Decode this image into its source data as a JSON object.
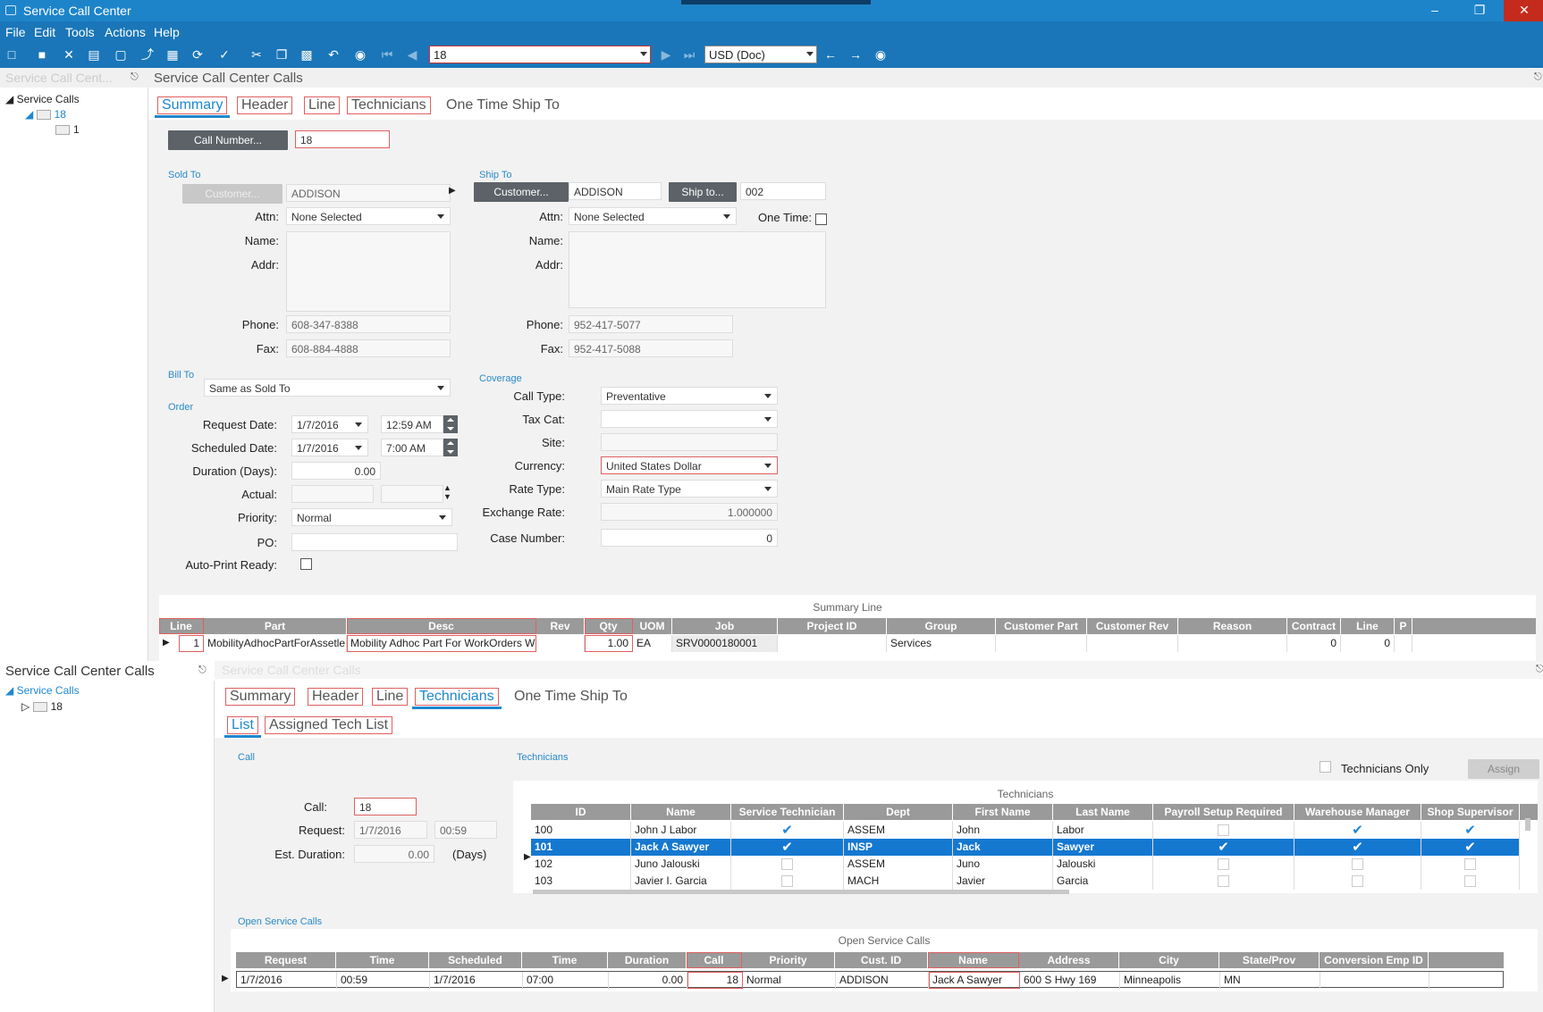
{
  "window": {
    "title": "Service Call Center",
    "min": "–",
    "restore": "❐",
    "close": "✕"
  },
  "menu": [
    "File",
    "Edit",
    "Tools",
    "Actions",
    "Help"
  ],
  "toolbar": {
    "record_value": "18",
    "currency": "USD (Doc)"
  },
  "top_pane": {
    "left_header": "Service Call Cent...",
    "header": "Service Call Center Calls",
    "tree": {
      "root": "Service Calls",
      "child": "18",
      "leaf": "1"
    },
    "tabs": [
      "Summary",
      "Header",
      "Line",
      "Technicians",
      "One Time Ship To"
    ],
    "call_number_btn": "Call Number...",
    "call_number": "18",
    "sold_to": {
      "section": "Sold To",
      "customer_btn": "Customer...",
      "customer": "ADDISON",
      "attn_label": "Attn:",
      "attn": "None Selected",
      "name_label": "Name:",
      "addr_label": "Addr:",
      "phone_label": "Phone:",
      "phone": "608-347-8388",
      "fax_label": "Fax:",
      "fax": "608-884-4888"
    },
    "ship_to": {
      "section": "Ship To",
      "customer_btn": "Customer...",
      "customer": "ADDISON",
      "shipto_btn": "Ship to...",
      "shipto": "002",
      "attn_label": "Attn:",
      "attn": "None Selected",
      "onetime_label": "One Time:",
      "name_label": "Name:",
      "addr_label": "Addr:",
      "phone_label": "Phone:",
      "phone": "952-417-5077",
      "fax_label": "Fax:",
      "fax": "952-417-5088"
    },
    "bill_to": {
      "section": "Bill To",
      "value": "Same as Sold To"
    },
    "order": {
      "section": "Order",
      "request_label": "Request Date:",
      "request_date": "1/7/2016",
      "request_time": "12:59 AM",
      "scheduled_label": "Scheduled Date:",
      "scheduled_date": "1/7/2016",
      "scheduled_time": "7:00 AM",
      "duration_label": "Duration (Days):",
      "duration": "0.00",
      "actual_label": "Actual:",
      "priority_label": "Priority:",
      "priority": "Normal",
      "po_label": "PO:",
      "autoprint_label": "Auto-Print Ready:"
    },
    "coverage": {
      "section": "Coverage",
      "calltype_label": "Call Type:",
      "calltype": "Preventative",
      "taxcat_label": "Tax Cat:",
      "site_label": "Site:",
      "currency_label": "Currency:",
      "currency": "United States Dollar",
      "ratetype_label": "Rate Type:",
      "ratetype": "Main Rate Type",
      "exrate_label": "Exchange Rate:",
      "exrate": "1.000000",
      "case_label": "Case Number:",
      "case": "0"
    },
    "summary_grid": {
      "title": "Summary Line",
      "columns": [
        "Line",
        "Part",
        "Desc",
        "Rev",
        "Qty",
        "UOM",
        "Job",
        "Project ID",
        "Group",
        "Customer Part",
        "Customer Rev",
        "Reason",
        "Contract",
        "Line",
        "P"
      ],
      "row": [
        "1",
        "MobilityAdhocPartForAssetle",
        "Mobility Adhoc Part For WorkOrders Wit",
        "",
        "1.00",
        "EA",
        "SRV0000180001",
        "",
        "Services",
        "",
        "",
        "",
        "0",
        "0",
        ""
      ]
    }
  },
  "bottom_pane": {
    "left_header": "Service Call Center Calls",
    "right_header": "Service Call Center Calls",
    "tree": {
      "root": "Service Calls",
      "child": "18"
    },
    "tabs": [
      "Summary",
      "Header",
      "Line",
      "Technicians",
      "One Time Ship To"
    ],
    "subtabs": [
      "List",
      "Assigned Tech List"
    ],
    "call": {
      "section": "Call",
      "call_label": "Call:",
      "call": "18",
      "request_label": "Request:",
      "request_date": "1/7/2016",
      "request_time": "00:59",
      "est_label": "Est. Duration:",
      "est": "0.00",
      "days": "(Days)"
    },
    "technicians": {
      "section": "Technicians",
      "only_label": "Technicians Only",
      "assign_btn": "Assign",
      "title": "Technicians",
      "columns": [
        "ID",
        "Name",
        "Service Technician",
        "Dept",
        "First Name",
        "Last Name",
        "Payroll Setup Required",
        "Warehouse Manager",
        "Shop Supervisor"
      ],
      "rows": [
        {
          "id": "100",
          "name": "John J Labor",
          "svc": true,
          "dept": "ASSEM",
          "first": "John",
          "last": "Labor",
          "payroll": false,
          "wh": true,
          "shop": true
        },
        {
          "id": "101",
          "name": "Jack A Sawyer",
          "svc": true,
          "dept": "INSP",
          "first": "Jack",
          "last": "Sawyer",
          "payroll": true,
          "wh": true,
          "shop": true
        },
        {
          "id": "102",
          "name": "Juno Jalouski",
          "svc": false,
          "dept": "ASSEM",
          "first": "Juno",
          "last": "Jalouski",
          "payroll": false,
          "wh": false,
          "shop": false
        },
        {
          "id": "103",
          "name": "Javier I. Garcia",
          "svc": false,
          "dept": "MACH",
          "first": "Javier",
          "last": "Garcia",
          "payroll": false,
          "wh": false,
          "shop": false
        }
      ]
    },
    "open_calls": {
      "section": "Open Service Calls",
      "title": "Open Service Calls",
      "columns": [
        "Request",
        "Time",
        "Scheduled",
        "Time",
        "Duration",
        "Call",
        "Priority",
        "Cust. ID",
        "Name",
        "Address",
        "City",
        "State/Prov",
        "Conversion Emp ID"
      ],
      "row": [
        "1/7/2016",
        "00:59",
        "1/7/2016",
        "07:00",
        "0.00",
        "18",
        "Normal",
        "ADDISON",
        "Jack A Sawyer",
        "600 S Hwy 169",
        "Minneapolis",
        "MN",
        ""
      ]
    }
  },
  "icons": {
    "check": "✔"
  }
}
